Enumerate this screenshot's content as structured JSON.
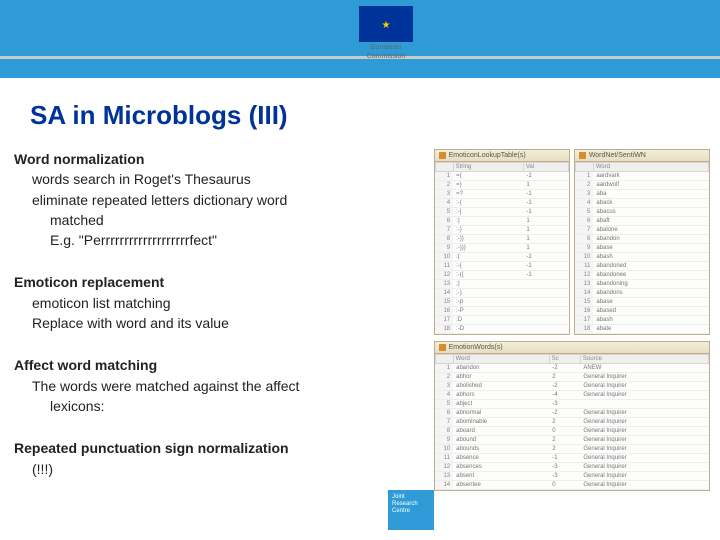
{
  "banner": {
    "org_line1": "European",
    "org_line2": "Commission"
  },
  "title": "SA in Microblogs (III)",
  "sections": [
    {
      "head": "Word normalization",
      "lines": [
        {
          "text": "words search in Roget's Thesaurus",
          "indent": 1
        },
        {
          "text": "eliminate repeated letters dictionary word",
          "indent": 1
        },
        {
          "text": "matched",
          "indent": 2
        },
        {
          "text": "E.g. \"Perrrrrrrrrrrrrrrrrrrfect\"",
          "indent": 2
        }
      ]
    },
    {
      "head": "Emoticon replacement",
      "lines": [
        {
          "text": "emoticon list matching",
          "indent": 1
        },
        {
          "text": "Replace with word and its value",
          "indent": 1
        }
      ]
    },
    {
      "head": "Affect word matching",
      "lines": [
        {
          "text": "The words were matched against the affect",
          "indent": 1
        },
        {
          "text": "lexicons:",
          "indent": 2
        }
      ]
    },
    {
      "head": "Repeated punctuation sign normalization",
      "lines": [
        {
          "text": "(!!!)",
          "indent": 1
        }
      ]
    }
  ],
  "panels": {
    "emoticon": {
      "title": "EmoticonLookupTable(s)",
      "headers": [
        "",
        "String",
        "Val"
      ],
      "rows": [
        [
          "1",
          "=(",
          "-1"
        ],
        [
          "2",
          "=)",
          "1"
        ],
        [
          "3",
          "=?",
          "-1"
        ],
        [
          "4",
          ":-(",
          "-1"
        ],
        [
          "5",
          ":-|",
          "-1"
        ],
        [
          "6",
          ":)",
          "1"
        ],
        [
          "7",
          ":-)",
          "1"
        ],
        [
          "8",
          ":-))",
          "1"
        ],
        [
          "9",
          ":-)))",
          "1"
        ],
        [
          "10",
          ":(",
          "-1"
        ],
        [
          "11",
          ":-(",
          "-1"
        ],
        [
          "12",
          ":-((",
          "-1"
        ],
        [
          "13",
          ";)",
          ""
        ],
        [
          "14",
          ";-)",
          ""
        ],
        [
          "15",
          ":-p",
          ""
        ],
        [
          "16",
          ":-P",
          ""
        ],
        [
          "17",
          ":D",
          ""
        ],
        [
          "18",
          ":-D",
          ""
        ]
      ]
    },
    "wordnet": {
      "title": "WordNet/SentiWN",
      "headers": [
        "",
        "Word"
      ],
      "rows": [
        [
          "1",
          "aardvark"
        ],
        [
          "2",
          "aardwolf"
        ],
        [
          "3",
          "aba"
        ],
        [
          "4",
          "aback"
        ],
        [
          "5",
          "abacus"
        ],
        [
          "6",
          "abaft"
        ],
        [
          "7",
          "abalone"
        ],
        [
          "8",
          "abandon"
        ],
        [
          "9",
          "abase"
        ],
        [
          "10",
          "abash"
        ],
        [
          "11",
          "abandoned"
        ],
        [
          "12",
          "abandonee"
        ],
        [
          "13",
          "abandoning"
        ],
        [
          "14",
          "abandons"
        ],
        [
          "15",
          "abase"
        ],
        [
          "16",
          "abased"
        ],
        [
          "17",
          "abash"
        ],
        [
          "18",
          "abate"
        ]
      ]
    },
    "emotion": {
      "title": "EmotionWords(s)",
      "headers": [
        "",
        "Word",
        "Sc",
        "Source"
      ],
      "rows": [
        [
          "1",
          "abandon",
          "-2",
          "ANEW"
        ],
        [
          "2",
          "abhor",
          "2",
          "General Inquirer"
        ],
        [
          "3",
          "abolished",
          "-2",
          "General Inquirer"
        ],
        [
          "4",
          "abhors",
          "-4",
          "General Inquirer"
        ],
        [
          "5",
          "abject",
          "-3",
          ""
        ],
        [
          "6",
          "abnormal",
          "-2",
          "General Inquirer"
        ],
        [
          "7",
          "abominable",
          "2",
          "General Inquirer"
        ],
        [
          "8",
          "aboard",
          "0",
          "General Inquirer"
        ],
        [
          "9",
          "abound",
          "2",
          "General Inquirer"
        ],
        [
          "10",
          "abounds",
          "2",
          "General Inquirer"
        ],
        [
          "11",
          "absence",
          "-1",
          "General Inquirer"
        ],
        [
          "12",
          "absences",
          "-3",
          "General Inquirer"
        ],
        [
          "13",
          "absent",
          "-3",
          "General Inquirer"
        ],
        [
          "14",
          "absentee",
          "0",
          "General Inquirer"
        ]
      ]
    }
  },
  "badge": "Joint Research Centre"
}
